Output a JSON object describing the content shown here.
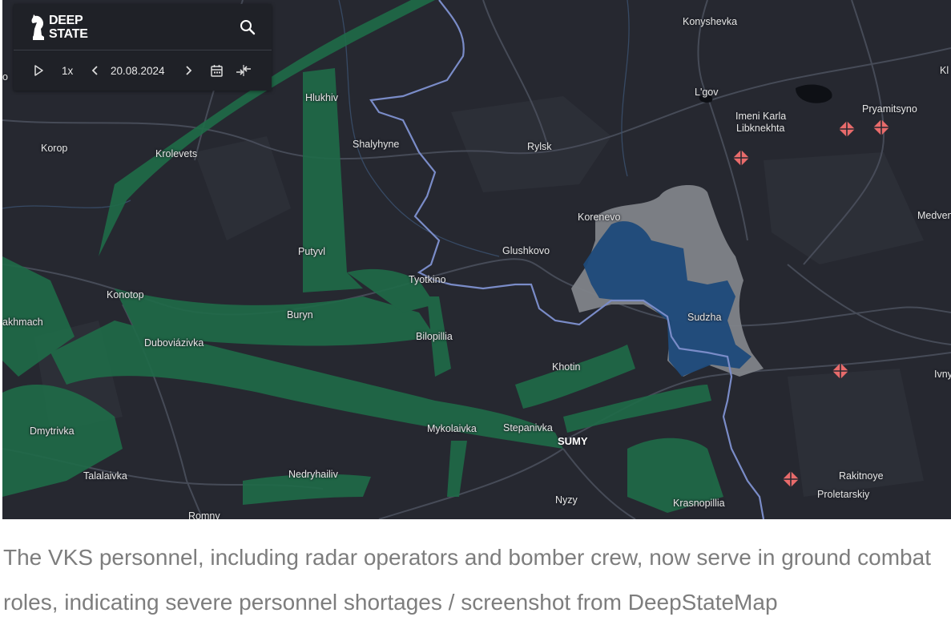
{
  "app": {
    "logo_line1": "DEEP",
    "logo_line2": "STATE"
  },
  "controls": {
    "speed": "1x",
    "date": "20.08.2024",
    "icons": [
      "play-icon",
      "chevron-left-icon",
      "chevron-right-icon",
      "calendar-icon",
      "compare-icon",
      "search-icon"
    ]
  },
  "colors": {
    "map_background": "#262830",
    "green_zone": "#1f6b48",
    "blue_zone": "#1d4a7a",
    "gray_zone": "#808389",
    "border": "#7a8cc8",
    "marker": "#e86b6b"
  },
  "places": {
    "konyshevka": "Konyshevka",
    "lgov": "L'gov",
    "imeni_karla_1": "Imeni Karla",
    "imeni_karla_2": "Libknekhta",
    "pryamitsyno": "Pryamitsyno",
    "hlukhiv": "Hlukhiv",
    "shalyhyne": "Shalyhyne",
    "rylsk": "Rylsk",
    "korop": "Korop",
    "krolevets": "Krolevets",
    "korenevo": "Korenevo",
    "medven": "Medven",
    "glushkovo": "Glushkovo",
    "putyvl": "Putyvl",
    "tyotkino": "Tyotkino",
    "konotop": "Konotop",
    "buryn": "Buryn",
    "sudzha": "Sudzha",
    "bakhmach": "akhmach",
    "bilopillia": "Bilopillia",
    "dubovia": "Duboviázivka",
    "khotin": "Khotin",
    "ivny": "Ivny",
    "dmytrivka": "Dmytrivka",
    "mykolaivka": "Mykolaivka",
    "stepanivka": "Stepanivka",
    "sumy": "SUMY",
    "talalaivka": "Talalaivka",
    "nedryhailiv": "Nedryhailiv",
    "rakitnoye": "Rakitnoye",
    "proletarskiy": "Proletarskiy",
    "nyzy": "Nyzy",
    "krasnopillia": "Krasnopillia",
    "romny": "Romny",
    "left_edge_o": "o",
    "kl": "Kl"
  },
  "caption": "The VKS personnel, including radar operators and bomber crew, now serve in ground combat roles, indicating severe personnel shortages / screenshot from DeepStateMap"
}
